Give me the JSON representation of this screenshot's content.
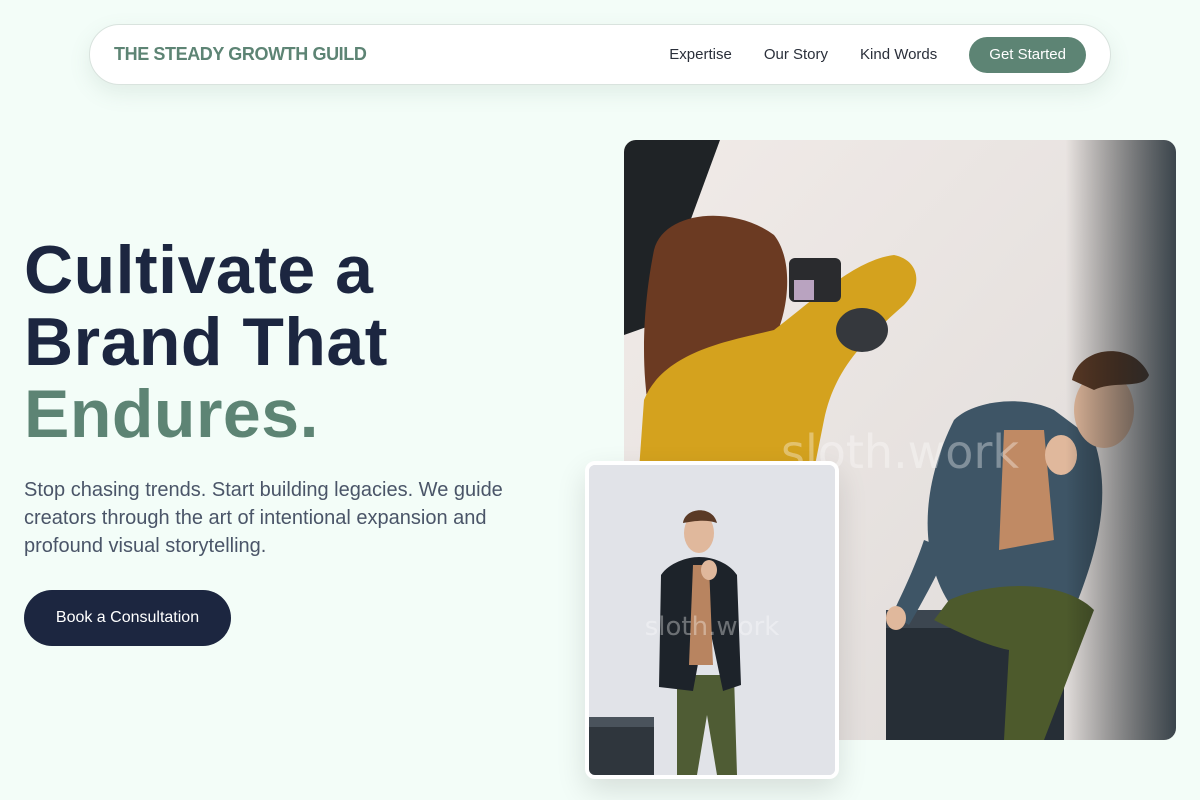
{
  "nav": {
    "brand": "THE STEADY GROWTH GUILD",
    "links": [
      "Expertise",
      "Our Story",
      "Kind Words"
    ],
    "cta": "Get Started"
  },
  "hero": {
    "headline_line1": "Cultivate a",
    "headline_line2": "Brand That",
    "headline_accent": "Endures.",
    "subtext": "Stop chasing trends. Start building legacies. We guide creators through the art of intentional expansion and profound visual storytelling.",
    "cta": "Book a Consultation"
  },
  "images": {
    "main_alt": "Photographer shooting a model in a denim jacket in a studio",
    "small_alt": "Model in a dark blazer and green trousers in a studio",
    "watermark": "sloth.work"
  },
  "colors": {
    "background": "#f3fdf8",
    "accent": "#5d8474",
    "dark": "#1c2640"
  }
}
